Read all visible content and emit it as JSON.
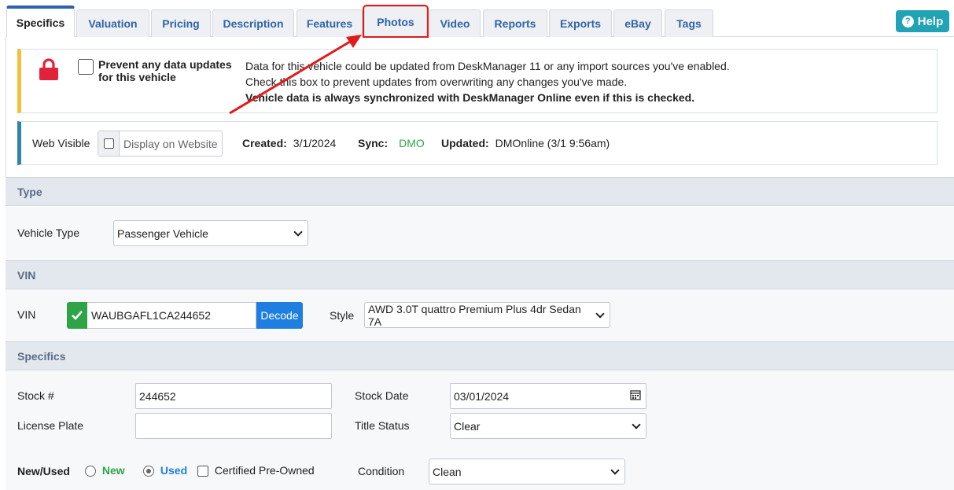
{
  "tabs": [
    {
      "label": "Specifics",
      "active": true
    },
    {
      "label": "Valuation"
    },
    {
      "label": "Pricing"
    },
    {
      "label": "Description"
    },
    {
      "label": "Features"
    },
    {
      "label": "Photos",
      "highlighted": true
    },
    {
      "label": "Video"
    },
    {
      "label": "Reports"
    },
    {
      "label": "Exports"
    },
    {
      "label": "eBay"
    },
    {
      "label": "Tags"
    }
  ],
  "help": {
    "label": "Help",
    "icon": "question-circle-icon"
  },
  "lock_notice": {
    "checkbox_label": "Prevent any data updates for this vehicle",
    "line1": "Data for this vehicle could be updated from DeskManager 11 or any import sources you've enabled.",
    "line2": "Check this box to prevent updates from overwriting any changes you've made.",
    "line3": "Vehicle data is always synchronized with DeskManager Online even if this is checked.",
    "icon": "lock-icon"
  },
  "web": {
    "label": "Web Visible",
    "placeholder": "Display on Website",
    "created_label": "Created:",
    "created_value": "3/1/2024",
    "sync_label": "Sync:",
    "sync_value": "DMO",
    "updated_label": "Updated:",
    "updated_value": "DMOnline (3/1 9:56am)"
  },
  "type_section": {
    "header": "Type",
    "vehicle_type_label": "Vehicle Type",
    "vehicle_type_value": "Passenger Vehicle"
  },
  "vin_section": {
    "header": "VIN",
    "vin_label": "VIN",
    "vin_value": "WAUBGAFL1CA244652",
    "decode_label": "Decode",
    "style_label": "Style",
    "style_value": "AWD 3.0T quattro Premium Plus 4dr Sedan 7A"
  },
  "specifics_section": {
    "header": "Specifics",
    "stock_label": "Stock #",
    "stock_value": "244652",
    "stock_date_label": "Stock Date",
    "stock_date_value": "03/01/2024",
    "license_label": "License Plate",
    "license_value": "",
    "title_status_label": "Title Status",
    "title_status_value": "Clear",
    "new_used_label": "New/Used",
    "new_label": "New",
    "used_label": "Used",
    "cpo_label": "Certified Pre-Owned",
    "condition_label": "Condition",
    "condition_value": "Clean"
  },
  "colors": {
    "accent_blue": "#2f63a8",
    "highlight_red": "#e01b1b",
    "help_teal": "#1fa3b5",
    "sync_green": "#2fa447",
    "lock_red": "#e2223a",
    "decode_blue": "#1e7fe0"
  }
}
